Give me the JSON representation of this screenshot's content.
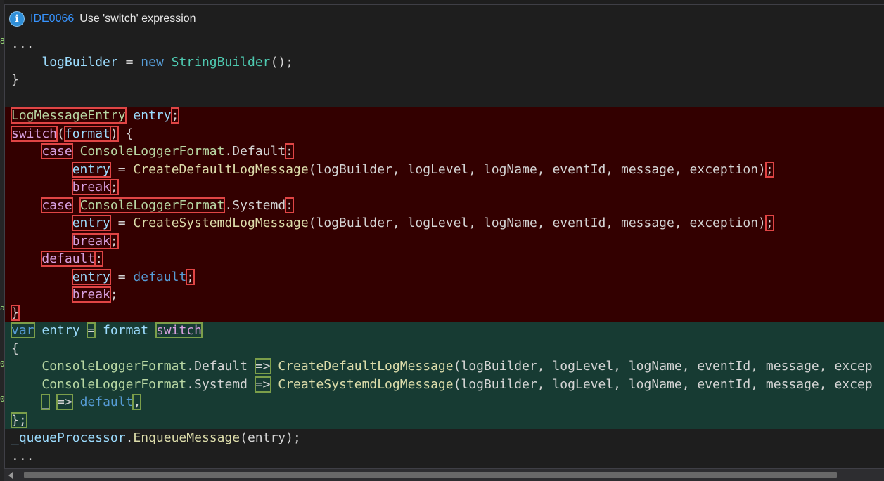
{
  "header": {
    "diagnostic_id": "IDE0066",
    "message": "Use 'switch' expression",
    "icon": "info-icon"
  },
  "gutter_marks": [
    "8",
    "a",
    "0",
    "0"
  ],
  "colors": {
    "removed_bg": "#330000",
    "added_bg": "#173b33",
    "accent": "#3794ff"
  },
  "code": {
    "ellipsis_top": "...",
    "builder_var": "logBuilder",
    "assign_op": "=",
    "new_kw": "new",
    "builder_type": "StringBuilder",
    "builder_call_end": "();",
    "close_brace": "}",
    "entry_type": "LogMessageEntry",
    "entry_name": "entry",
    "semicolon": ";",
    "switch_kw": "switch",
    "lparen": "(",
    "format_name": "format",
    "rparen": ")",
    "open_brace": "{",
    "case_kw": "case",
    "format_type": "ConsoleLoggerFormat",
    "default_member": ".Default",
    "systemd_member": ".Systemd",
    "colon": ":",
    "default_fn": "CreateDefaultLogMessage",
    "systemd_fn": "CreateSystemdLogMessage",
    "args": "(logBuilder, logLevel, logName, eventId, message, exception)",
    "args_truncated": "(logBuilder, logLevel, logName, eventId, message, excep",
    "break_kw": "break",
    "default_kw": "default",
    "var_kw": "var",
    "arrow": "=>",
    "discard": "_",
    "comma": ",",
    "close_brace_semi": "};",
    "queue_name": "_queueProcessor",
    "enqueue_fn": "EnqueueMessage",
    "enqueue_args": "(entry);",
    "ellipsis_bottom": "..."
  }
}
